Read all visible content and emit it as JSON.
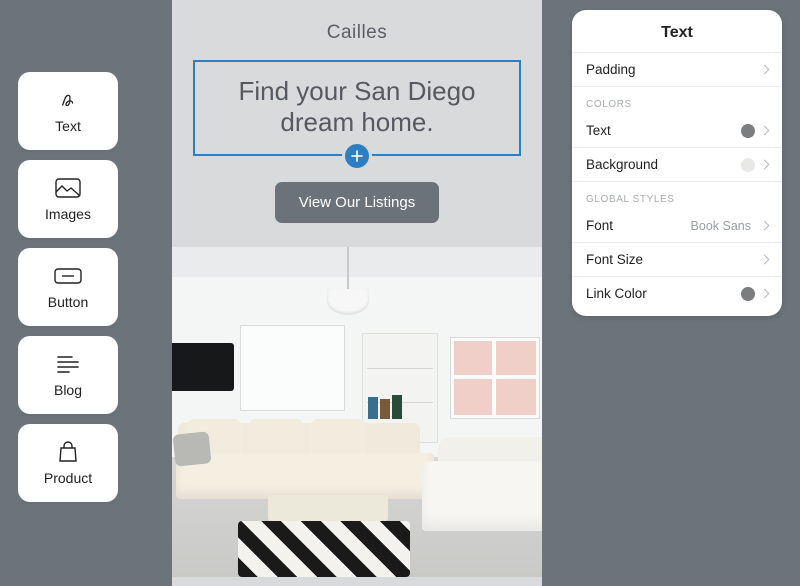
{
  "tools": {
    "text": {
      "label": "Text"
    },
    "images": {
      "label": "Images"
    },
    "button": {
      "label": "Button"
    },
    "blog": {
      "label": "Blog"
    },
    "product": {
      "label": "Product"
    }
  },
  "canvas": {
    "site_title": "Cailles",
    "headline": "Find your San Diego dream home.",
    "cta_label": "View Our Listings"
  },
  "inspector": {
    "title": "Text",
    "rows": {
      "padding": {
        "label": "Padding"
      },
      "text_color": {
        "label": "Text",
        "swatch": "#7b7d7e"
      },
      "bg_color": {
        "label": "Background",
        "swatch": "#e8e8e6"
      },
      "font": {
        "label": "Font",
        "value": "Book Sans"
      },
      "font_size": {
        "label": "Font Size"
      },
      "link_color": {
        "label": "Link Color",
        "swatch": "#7b7d7e"
      }
    },
    "sections": {
      "colors": "COLORS",
      "global": "GLOBAL STYLES"
    }
  }
}
